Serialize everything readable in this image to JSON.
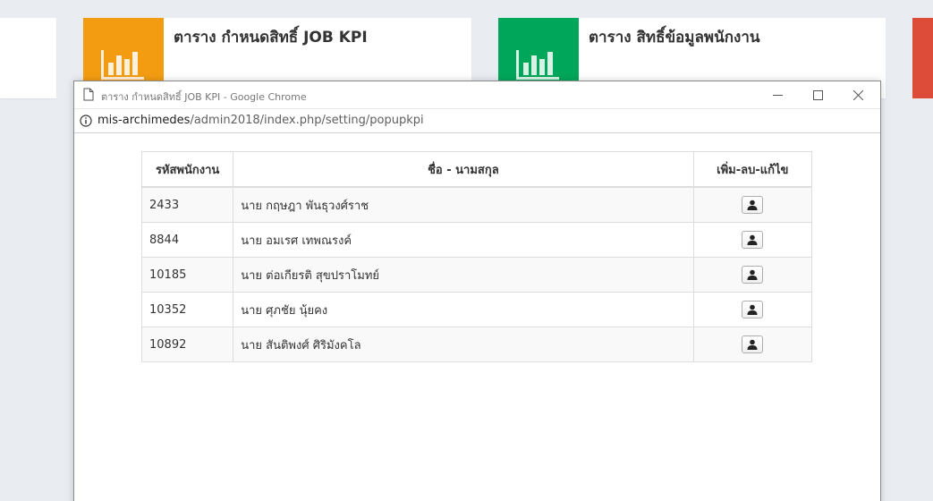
{
  "dashboard": {
    "cards": [
      {
        "title": "ตาราง กำหนดสิทธิ์ JOB KPI",
        "color": "#f39c12",
        "icon": "bar-chart-icon"
      },
      {
        "title": "ตาราง สิทธิ์ข้อมูลพนักงาน",
        "color": "#00a65a",
        "icon": "bar-chart-icon"
      }
    ],
    "right_card_color": "#dd4b39"
  },
  "popup": {
    "window_title": "ตาราง กำหนดสิทธิ์ JOB KPI - Google Chrome",
    "url_host": "mis-archimedes",
    "url_path": "/admin2018/index.php/setting/popupkpi"
  },
  "table": {
    "headers": [
      "รหัสพนักงาน",
      "ชื่อ - นามสกุล",
      "เพิ่ม-ลบ-แก้ไข"
    ],
    "rows": [
      {
        "id": "2433",
        "name": "นาย กฤษฎา พันธุวงศ์ราช",
        "action_icon": "user-icon"
      },
      {
        "id": "8844",
        "name": "นาย อมเรศ เทพณรงค์",
        "action_icon": "user-icon"
      },
      {
        "id": "10185",
        "name": "นาย ต่อเกียรติ สุขปราโมทย์",
        "action_icon": "user-icon"
      },
      {
        "id": "10352",
        "name": "นาย ศุภชัย นุ้ยคง",
        "action_icon": "user-icon"
      },
      {
        "id": "10892",
        "name": "นาย สันติพงศ์ ศิริมังคโล",
        "action_icon": "user-icon"
      }
    ]
  }
}
